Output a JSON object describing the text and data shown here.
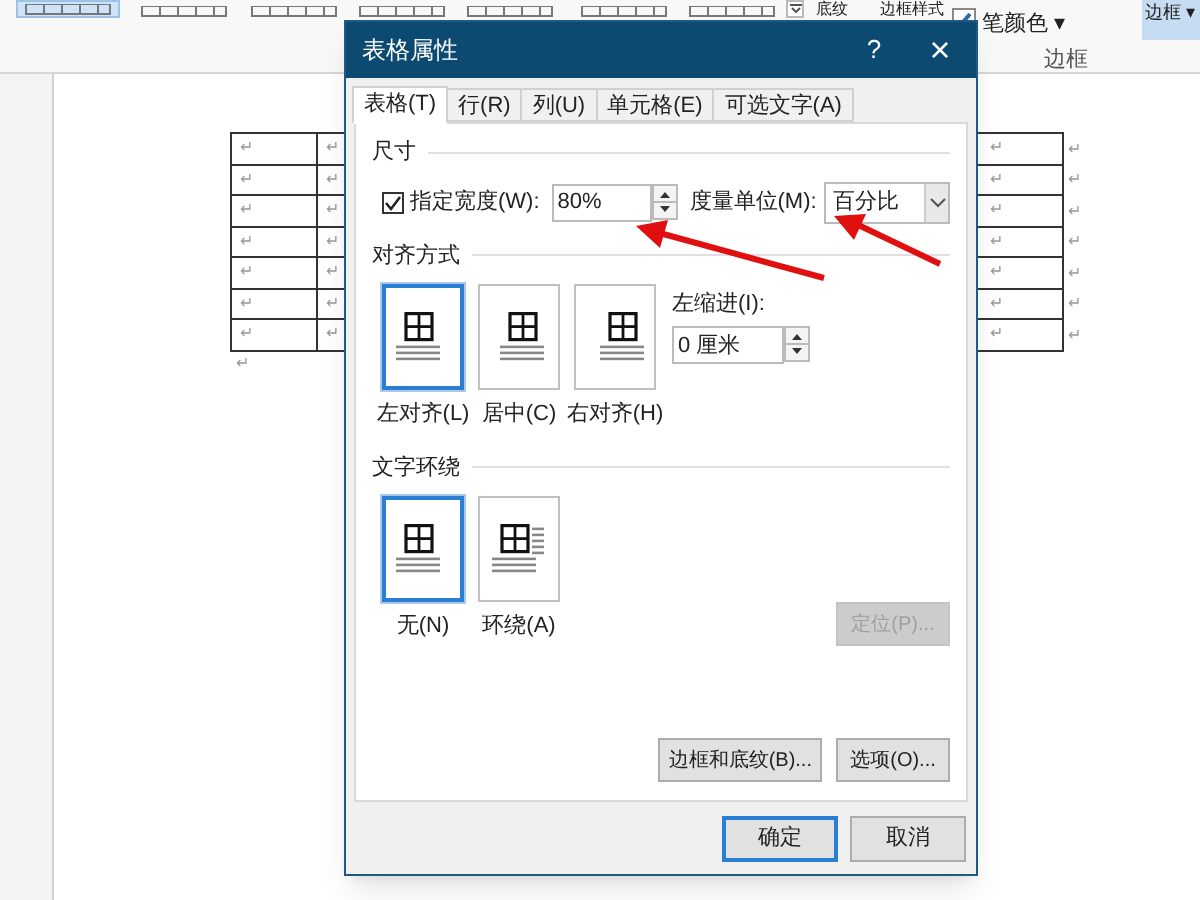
{
  "ribbon": {
    "style_thumbnails": [
      {
        "selected": true
      },
      {
        "selected": false
      },
      {
        "selected": false
      },
      {
        "selected": false
      },
      {
        "selected": false
      },
      {
        "selected": false
      },
      {
        "selected": false
      }
    ],
    "shading_label": "底纹",
    "border_styles_label": "边框样式",
    "pen_color": {
      "label": "笔颜色",
      "caret": "▾"
    },
    "borders_button": {
      "label": "边框",
      "caret": "▾"
    },
    "group_label": "边框"
  },
  "document": {
    "left_table": {
      "rows": [
        [
          "↵",
          "↵"
        ],
        [
          "↵",
          "↵"
        ],
        [
          "↵",
          "↵"
        ],
        [
          "↵",
          "↵"
        ],
        [
          "↵",
          "↵"
        ],
        [
          "↵",
          "↵"
        ],
        [
          "↵",
          "↵"
        ]
      ]
    },
    "after_table_mark": "↵",
    "right_table": {
      "rows": [
        {
          "cell": "↵",
          "end_mark": "↵"
        },
        {
          "cell": "↵",
          "end_mark": "↵"
        },
        {
          "cell": "↵",
          "end_mark": "↵"
        },
        {
          "cell": "↵",
          "end_mark": "↵"
        },
        {
          "cell": "↵",
          "end_mark": "↵"
        },
        {
          "cell": "↵",
          "end_mark": "↵"
        },
        {
          "cell": "↵",
          "end_mark": "↵"
        }
      ]
    }
  },
  "dialog": {
    "title": "表格属性",
    "help": "?",
    "close": "×",
    "tabs": [
      {
        "label": "表格(T)",
        "selected": true
      },
      {
        "label": "行(R)",
        "selected": false
      },
      {
        "label": "列(U)",
        "selected": false
      },
      {
        "label": "单元格(E)",
        "selected": false
      },
      {
        "label": "可选文字(A)",
        "selected": false
      }
    ],
    "size": {
      "section": "尺寸",
      "width_checkbox": {
        "label": "指定宽度(W):",
        "checked": true
      },
      "width_value": "80%",
      "unit_label": "度量单位(M):",
      "unit_value": "百分比"
    },
    "alignment": {
      "section": "对齐方式",
      "options": [
        {
          "label": "左对齐(L)",
          "selected": true,
          "kind": "left"
        },
        {
          "label": "居中(C)",
          "selected": false,
          "kind": "center"
        },
        {
          "label": "右对齐(H)",
          "selected": false,
          "kind": "right"
        }
      ],
      "indent_label": "左缩进(I):",
      "indent_value": "0 厘米"
    },
    "wrapping": {
      "section": "文字环绕",
      "options": [
        {
          "label": "无(N)",
          "selected": true,
          "kind": "none"
        },
        {
          "label": "环绕(A)",
          "selected": false,
          "kind": "around"
        }
      ],
      "position_button": {
        "label": "定位(P)...",
        "disabled": true
      }
    },
    "buttons": [
      {
        "label": "边框和底纹(B)..."
      },
      {
        "label": "选项(O)..."
      }
    ],
    "footer": [
      {
        "label": "确定",
        "default": true
      },
      {
        "label": "取消",
        "default": false
      }
    ]
  }
}
